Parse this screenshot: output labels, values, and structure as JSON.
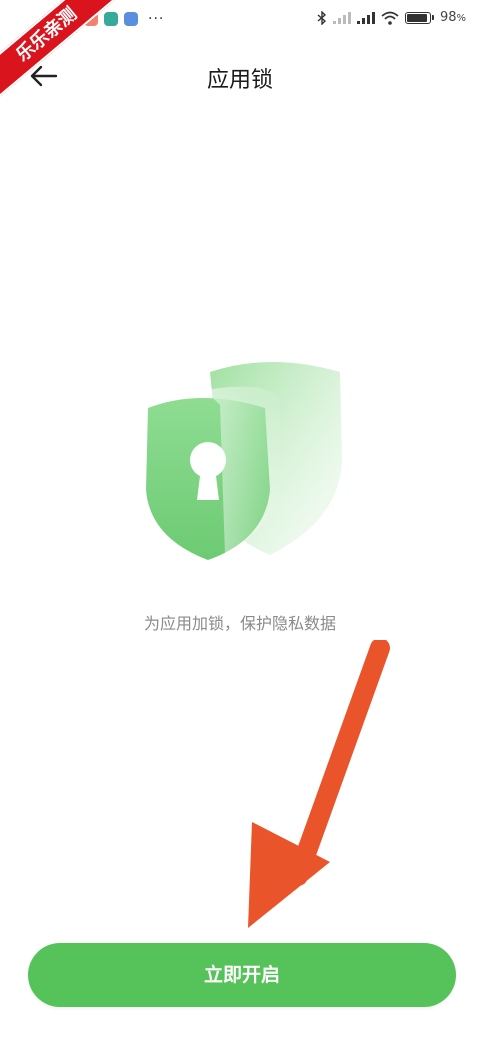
{
  "status_bar": {
    "battery_percent": "98",
    "battery_unit": "%",
    "battery_level": 0.98,
    "left_icons": [
      "app-icon-orange",
      "app-icon-teal",
      "app-icon-blue"
    ],
    "more": "···"
  },
  "watermark": {
    "text": "乐乐亲测"
  },
  "header": {
    "title": "应用锁",
    "back_icon": "arrow-left-icon"
  },
  "main": {
    "illustration_icon": "shield-lock-icon",
    "description": "为应用加锁，保护隐私数据"
  },
  "footer": {
    "enable_button_label": "立即开启"
  },
  "colors": {
    "accent": "#56c25a",
    "arrow": "#e9542a",
    "watermark": "#d9141c"
  }
}
